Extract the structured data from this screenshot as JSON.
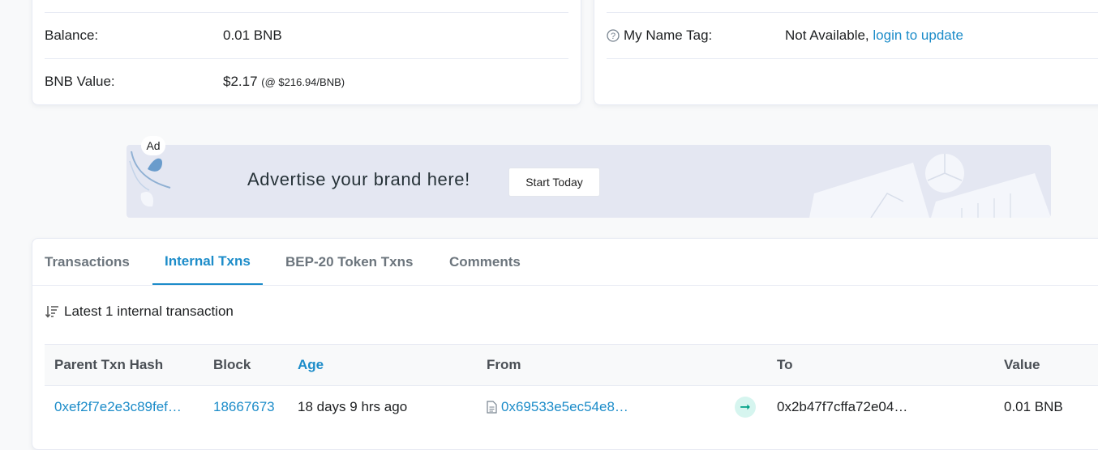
{
  "overview": {
    "balance_label": "Balance:",
    "balance_value": "0.01 BNB",
    "value_label": "BNB Value:",
    "value_amount": "$2.17",
    "value_rate": "(@ $216.94/BNB)"
  },
  "more_info": {
    "name_tag_label": "My Name Tag:",
    "name_tag_value": "Not Available,",
    "login_link": "login to update"
  },
  "ad": {
    "badge": "Ad",
    "text": "Advertise your brand here!",
    "button": "Start Today"
  },
  "tabs": [
    {
      "label": "Transactions",
      "active": false
    },
    {
      "label": "Internal Txns",
      "active": true
    },
    {
      "label": "BEP-20 Token Txns",
      "active": false
    },
    {
      "label": "Comments",
      "active": false
    }
  ],
  "summary": "Latest 1 internal transaction",
  "table": {
    "columns": [
      "Parent Txn Hash",
      "Block",
      "Age",
      "From",
      "To",
      "Value"
    ],
    "rows": [
      {
        "hash": "0xef2f7e2e3c89fef…",
        "block": "18667673",
        "age": "18 days 9 hrs ago",
        "from": "0x69533e5ec54e8…",
        "to": "0x2b47f7cffa72e04…",
        "value": "0.01 BNB"
      }
    ]
  },
  "colors": {
    "link": "#1c8cc9",
    "arrow": "#00a186",
    "arrow_bg": "#d6f5ef"
  },
  "icons": [
    "question-circle-icon",
    "sort-desc-icon",
    "contract-file-icon",
    "arrow-right-icon",
    "ad-leaf-icon"
  ]
}
